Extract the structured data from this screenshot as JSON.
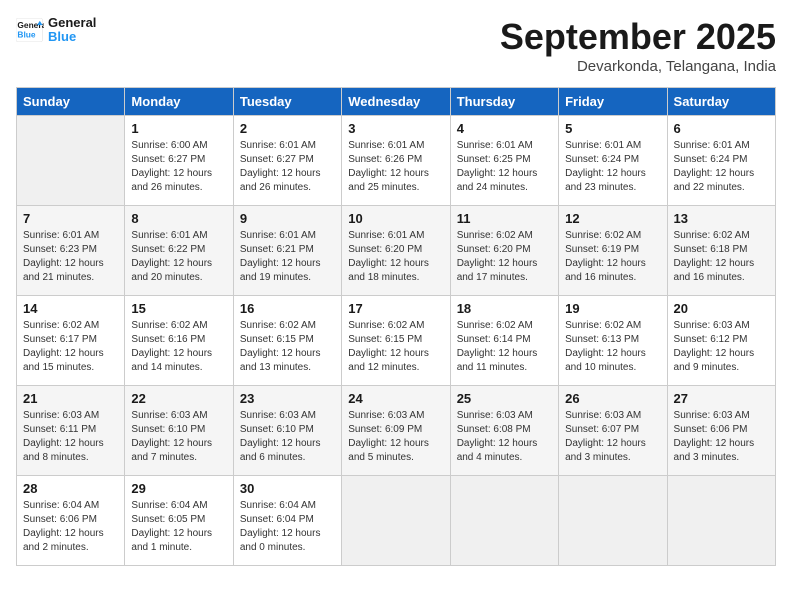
{
  "logo": {
    "line1": "General",
    "line2": "Blue"
  },
  "title": "September 2025",
  "location": "Devarkonda, Telangana, India",
  "weekdays": [
    "Sunday",
    "Monday",
    "Tuesday",
    "Wednesday",
    "Thursday",
    "Friday",
    "Saturday"
  ],
  "weeks": [
    [
      {
        "day": "",
        "empty": true
      },
      {
        "day": "1",
        "sunrise": "6:00 AM",
        "sunset": "6:27 PM",
        "daylight": "12 hours and 26 minutes."
      },
      {
        "day": "2",
        "sunrise": "6:01 AM",
        "sunset": "6:27 PM",
        "daylight": "12 hours and 26 minutes."
      },
      {
        "day": "3",
        "sunrise": "6:01 AM",
        "sunset": "6:26 PM",
        "daylight": "12 hours and 25 minutes."
      },
      {
        "day": "4",
        "sunrise": "6:01 AM",
        "sunset": "6:25 PM",
        "daylight": "12 hours and 24 minutes."
      },
      {
        "day": "5",
        "sunrise": "6:01 AM",
        "sunset": "6:24 PM",
        "daylight": "12 hours and 23 minutes."
      },
      {
        "day": "6",
        "sunrise": "6:01 AM",
        "sunset": "6:24 PM",
        "daylight": "12 hours and 22 minutes."
      }
    ],
    [
      {
        "day": "7",
        "sunrise": "6:01 AM",
        "sunset": "6:23 PM",
        "daylight": "12 hours and 21 minutes."
      },
      {
        "day": "8",
        "sunrise": "6:01 AM",
        "sunset": "6:22 PM",
        "daylight": "12 hours and 20 minutes."
      },
      {
        "day": "9",
        "sunrise": "6:01 AM",
        "sunset": "6:21 PM",
        "daylight": "12 hours and 19 minutes."
      },
      {
        "day": "10",
        "sunrise": "6:01 AM",
        "sunset": "6:20 PM",
        "daylight": "12 hours and 18 minutes."
      },
      {
        "day": "11",
        "sunrise": "6:02 AM",
        "sunset": "6:20 PM",
        "daylight": "12 hours and 17 minutes."
      },
      {
        "day": "12",
        "sunrise": "6:02 AM",
        "sunset": "6:19 PM",
        "daylight": "12 hours and 16 minutes."
      },
      {
        "day": "13",
        "sunrise": "6:02 AM",
        "sunset": "6:18 PM",
        "daylight": "12 hours and 16 minutes."
      }
    ],
    [
      {
        "day": "14",
        "sunrise": "6:02 AM",
        "sunset": "6:17 PM",
        "daylight": "12 hours and 15 minutes."
      },
      {
        "day": "15",
        "sunrise": "6:02 AM",
        "sunset": "6:16 PM",
        "daylight": "12 hours and 14 minutes."
      },
      {
        "day": "16",
        "sunrise": "6:02 AM",
        "sunset": "6:15 PM",
        "daylight": "12 hours and 13 minutes."
      },
      {
        "day": "17",
        "sunrise": "6:02 AM",
        "sunset": "6:15 PM",
        "daylight": "12 hours and 12 minutes."
      },
      {
        "day": "18",
        "sunrise": "6:02 AM",
        "sunset": "6:14 PM",
        "daylight": "12 hours and 11 minutes."
      },
      {
        "day": "19",
        "sunrise": "6:02 AM",
        "sunset": "6:13 PM",
        "daylight": "12 hours and 10 minutes."
      },
      {
        "day": "20",
        "sunrise": "6:03 AM",
        "sunset": "6:12 PM",
        "daylight": "12 hours and 9 minutes."
      }
    ],
    [
      {
        "day": "21",
        "sunrise": "6:03 AM",
        "sunset": "6:11 PM",
        "daylight": "12 hours and 8 minutes."
      },
      {
        "day": "22",
        "sunrise": "6:03 AM",
        "sunset": "6:10 PM",
        "daylight": "12 hours and 7 minutes."
      },
      {
        "day": "23",
        "sunrise": "6:03 AM",
        "sunset": "6:10 PM",
        "daylight": "12 hours and 6 minutes."
      },
      {
        "day": "24",
        "sunrise": "6:03 AM",
        "sunset": "6:09 PM",
        "daylight": "12 hours and 5 minutes."
      },
      {
        "day": "25",
        "sunrise": "6:03 AM",
        "sunset": "6:08 PM",
        "daylight": "12 hours and 4 minutes."
      },
      {
        "day": "26",
        "sunrise": "6:03 AM",
        "sunset": "6:07 PM",
        "daylight": "12 hours and 3 minutes."
      },
      {
        "day": "27",
        "sunrise": "6:03 AM",
        "sunset": "6:06 PM",
        "daylight": "12 hours and 3 minutes."
      }
    ],
    [
      {
        "day": "28",
        "sunrise": "6:04 AM",
        "sunset": "6:06 PM",
        "daylight": "12 hours and 2 minutes."
      },
      {
        "day": "29",
        "sunrise": "6:04 AM",
        "sunset": "6:05 PM",
        "daylight": "12 hours and 1 minute."
      },
      {
        "day": "30",
        "sunrise": "6:04 AM",
        "sunset": "6:04 PM",
        "daylight": "12 hours and 0 minutes."
      },
      {
        "day": "",
        "empty": true
      },
      {
        "day": "",
        "empty": true
      },
      {
        "day": "",
        "empty": true
      },
      {
        "day": "",
        "empty": true
      }
    ]
  ]
}
